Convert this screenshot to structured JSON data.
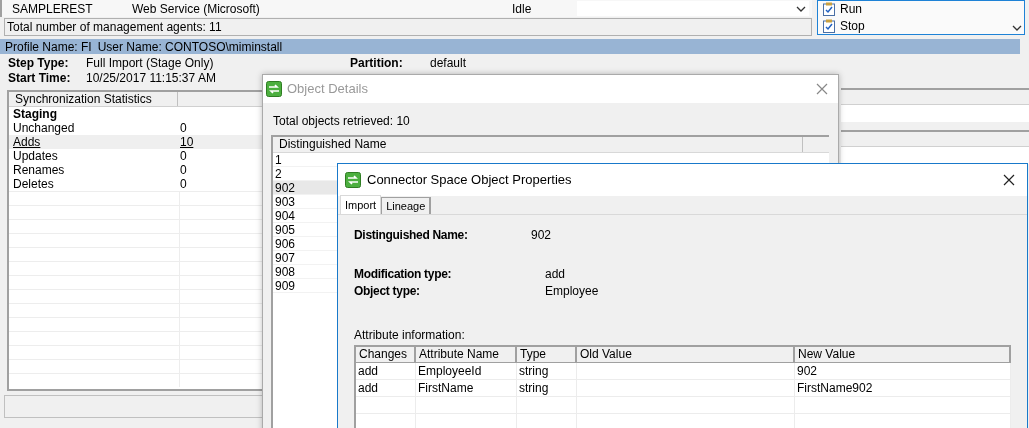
{
  "agents_table": {
    "rows": [
      {
        "name": "SAMPLEREST",
        "type": "Web Service (Microsoft)",
        "state": "Idle"
      }
    ]
  },
  "actions": [
    {
      "label": "Run"
    },
    {
      "label": "Stop"
    }
  ],
  "status_bar": "Total number of management agents: 11",
  "profile_bar": {
    "profile": "Profile Name: FI",
    "user": "User Name: CONTOSO\\miminstall"
  },
  "run_details": [
    {
      "label": "Step Type:",
      "value": "Full Import (Stage Only)"
    },
    {
      "label": "Partition:",
      "value": "default"
    },
    {
      "label": "Start Time:",
      "value": "10/25/2017 11:15:37 AM"
    }
  ],
  "sync_statistics": {
    "header": "Synchronization Statistics",
    "rows": [
      {
        "kind": "group",
        "label": "Staging",
        "selected": false
      },
      {
        "kind": "stat",
        "label": "Unchanged",
        "value": "0",
        "selected": false
      },
      {
        "kind": "link",
        "label": "Adds",
        "value": "10",
        "selected": true
      },
      {
        "kind": "stat",
        "label": "Updates",
        "value": "0",
        "selected": false
      },
      {
        "kind": "stat",
        "label": "Renames",
        "value": "0",
        "selected": false
      },
      {
        "kind": "stat",
        "label": "Deletes",
        "value": "0",
        "selected": false
      }
    ]
  },
  "object_details": {
    "title": "Object Details",
    "summary": "Total objects retrieved: 10",
    "column": "Distinguished Name",
    "rows": [
      {
        "name": "1",
        "selected": false
      },
      {
        "name": "2",
        "selected": false
      },
      {
        "name": "902",
        "selected": true
      },
      {
        "name": "903",
        "selected": false
      },
      {
        "name": "904",
        "selected": false
      },
      {
        "name": "905",
        "selected": false
      },
      {
        "name": "906",
        "selected": false
      },
      {
        "name": "907",
        "selected": false
      },
      {
        "name": "908",
        "selected": false
      },
      {
        "name": "909",
        "selected": false
      }
    ]
  },
  "properties": {
    "title": "Connector Space Object Properties",
    "tabs": [
      {
        "label": "Import",
        "selected": true
      },
      {
        "label": "Lineage",
        "selected": false
      }
    ],
    "fields": [
      {
        "label": "Distinguished Name:",
        "value": "902"
      },
      {
        "label": "Modification type:",
        "value": "add"
      },
      {
        "label": "Object type:",
        "value": "Employee"
      }
    ],
    "attributes_label": "Attribute information:",
    "table": {
      "columns": [
        "Changes",
        "Attribute Name",
        "Type",
        "Old Value",
        "New Value"
      ],
      "rows": [
        [
          "add",
          "EmployeeId",
          "string",
          "",
          "902"
        ],
        [
          "add",
          "FirstName",
          "string",
          "",
          "FirstName902"
        ]
      ]
    }
  }
}
